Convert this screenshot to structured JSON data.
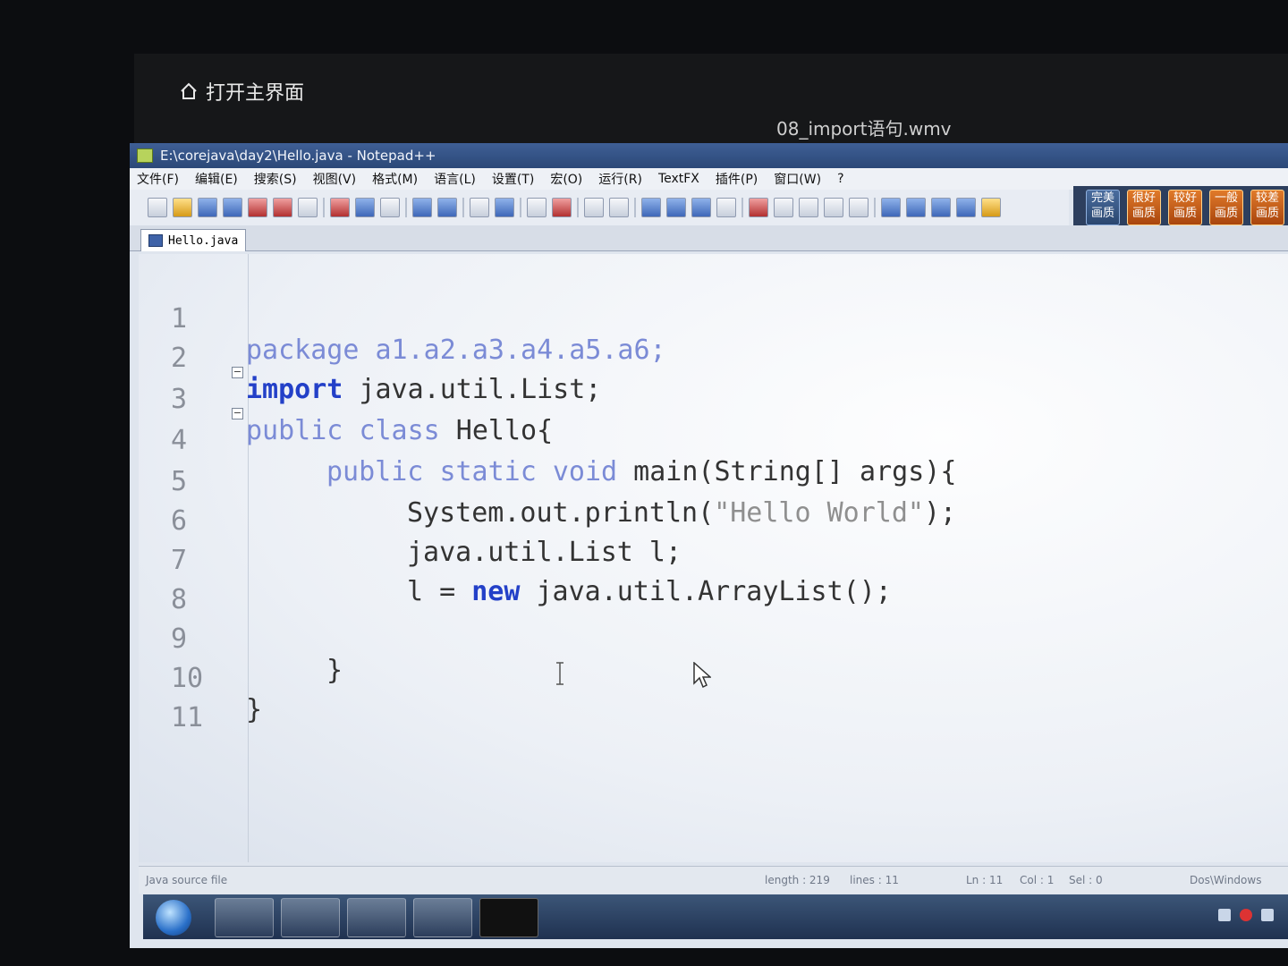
{
  "player": {
    "home_label": "打开主界面",
    "video_title": "08_import语句.wmv"
  },
  "window": {
    "title": "E:\\corejava\\day2\\Hello.java - Notepad++"
  },
  "menu": [
    "文件(F)",
    "编辑(E)",
    "搜索(S)",
    "视图(V)",
    "格式(M)",
    "语言(L)",
    "设置(T)",
    "宏(O)",
    "运行(R)",
    "TextFX",
    "插件(P)",
    "窗口(W)",
    "?"
  ],
  "quality": [
    "完美画质",
    "很好画质",
    "较好画质",
    "一般画质",
    "较差画质"
  ],
  "tab": {
    "label": "Hello.java"
  },
  "code": {
    "line1": "package a1.a2.a3.a4.a5.a6;",
    "line2_kw": "import",
    "line2_rest": " java.util.List;",
    "line3_public": "public",
    "line3_class": "class",
    "line3_rest": " Hello{",
    "line4_public": "public",
    "line4_static": "static",
    "line4_void": "void",
    "line4_rest": " main(String[] args){",
    "line5_pre": "System.out.println(",
    "line5_str": "\"Hello World\"",
    "line5_post": ");",
    "line6": "java.util.List l;",
    "line7_pre": "l = ",
    "line7_new": "new",
    "line7_rest": " java.util.ArrayList();",
    "line9": "}",
    "line10": "}",
    "line_numbers": [
      "1",
      "2",
      "3",
      "4",
      "5",
      "6",
      "7",
      "8",
      "9",
      "10",
      "11"
    ]
  },
  "status": {
    "file_type": "Java source file",
    "length": "length : 219",
    "lines": "lines : 11",
    "ln": "Ln : 11",
    "col": "Col : 1",
    "sel": "Sel : 0",
    "eol": "Dos\\Windows"
  }
}
